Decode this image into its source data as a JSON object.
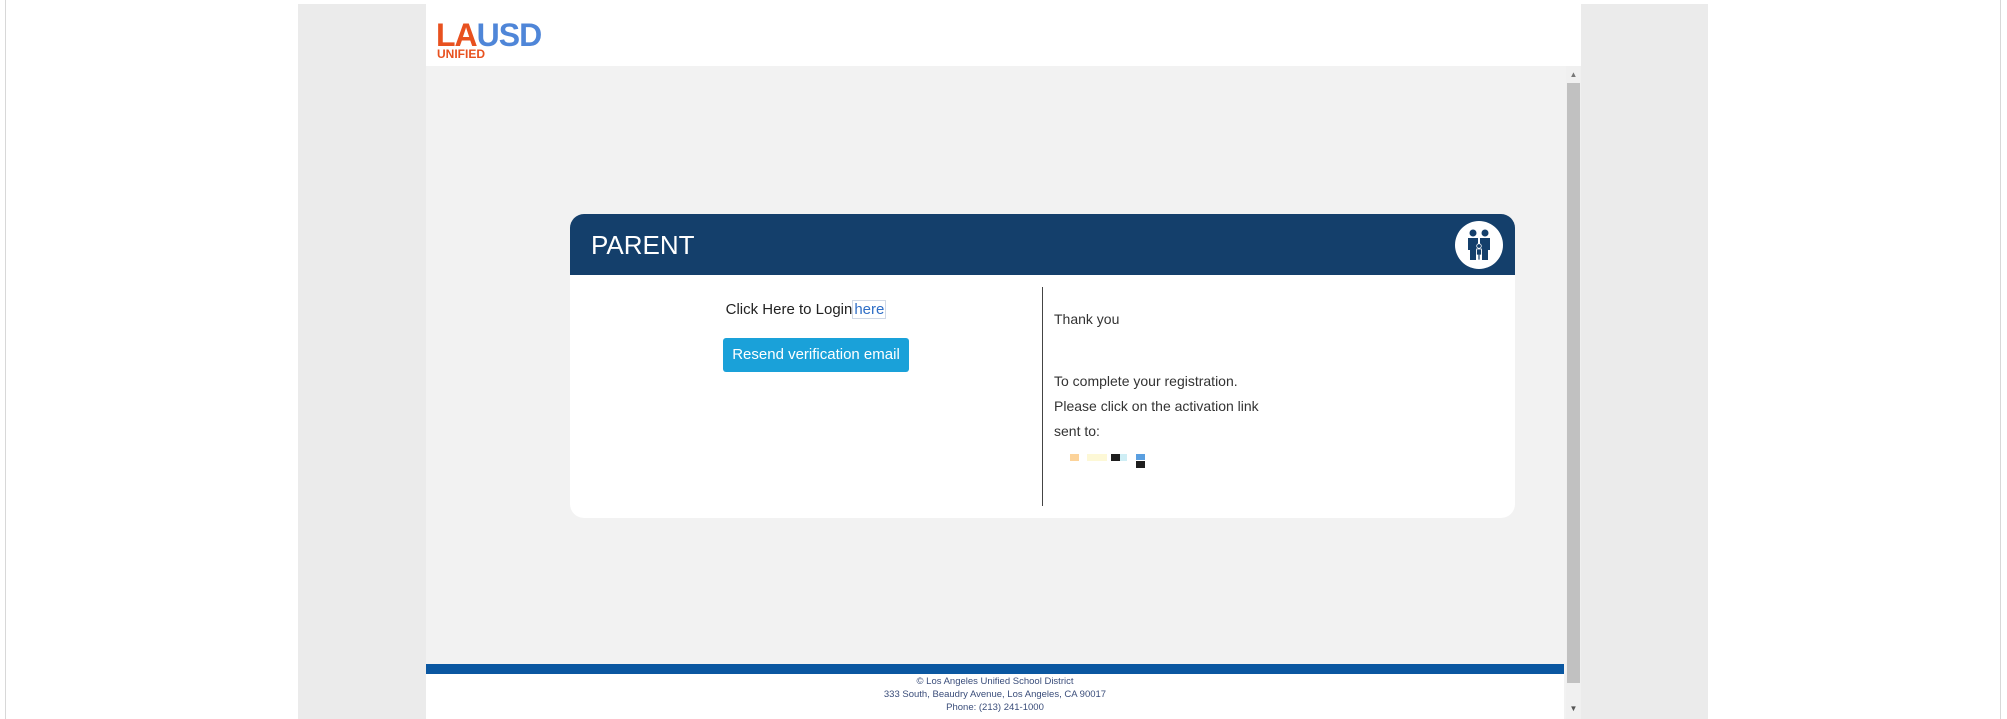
{
  "header": {
    "logo": {
      "la": "LA",
      "usd": "USD",
      "sub": "UNIFIED"
    }
  },
  "card": {
    "title": "PARENT",
    "icon": "parent-family-icon",
    "login_prefix": "Click Here to Login",
    "login_link": "here",
    "resend_label": "Resend verification email",
    "thanks": "Thank you",
    "line1": "To complete your registration.",
    "line2": "Please click on the activation link",
    "line3": "sent to:"
  },
  "footer": {
    "copyright": "© Los Angeles Unified School District",
    "address": "333 South, Beaudry Avenue, Los Angeles, CA 90017",
    "phone": "Phone: (213) 241-1000"
  },
  "colors": {
    "header_bg": "#143f6b",
    "button_bg": "#1aa1d9",
    "footer_bar": "#0a57a1",
    "logo_orange": "#e8511f",
    "logo_blue": "#4f86d8"
  }
}
